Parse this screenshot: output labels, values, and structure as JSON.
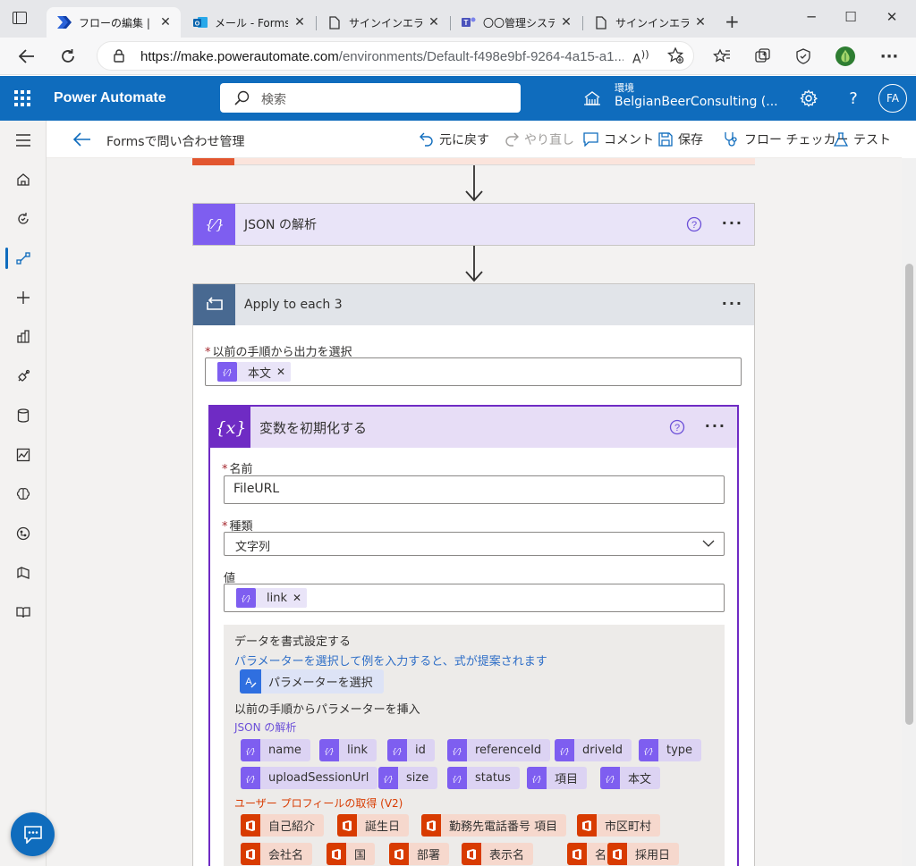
{
  "browser": {
    "tabs": [
      {
        "title": "フローの編集 | Po",
        "icon": "power-automate-icon"
      },
      {
        "title": "メール - Forms /",
        "icon": "outlook-icon"
      },
      {
        "title": "サインインエラー_",
        "icon": "page-icon"
      },
      {
        "title": "〇〇管理システ",
        "icon": "teams-icon"
      },
      {
        "title": "サインインエラー_",
        "icon": "page-icon"
      }
    ],
    "url_main": "https://make.powerautomate.com",
    "url_rest": "/environments/Default-f498e9bf-9264-4a15-a1..."
  },
  "header": {
    "app_title": "Power Automate",
    "search_placeholder": "検索",
    "env_label": "環境",
    "env_name": "BelgianBeerConsulting (...",
    "avatar_initials": "FA"
  },
  "command_bar": {
    "flow_name": "Formsで問い合わせ管理",
    "undo": "元に戻す",
    "redo": "やり直し",
    "comment": "コメント",
    "save": "保存",
    "flow_checker": "フロー チェッカー",
    "test": "テスト"
  },
  "json_step": {
    "title": "JSON の解析"
  },
  "apply_step": {
    "title": "Apply to each 3",
    "field_label": "以前の手順から出力を選択",
    "token": "本文"
  },
  "var_step": {
    "title": "変数を初期化する",
    "name_label": "名前",
    "name_value": "FileURL",
    "type_label": "種類",
    "type_value": "文字列",
    "value_label": "値",
    "value_token": "link"
  },
  "dynamic_panel": {
    "format_heading": "データを書式設定する",
    "format_hint": "パラメーターを選択して例を入力すると、式が提案されます",
    "param_button": "パラメーターを選択",
    "insert_heading": "以前の手順からパラメーターを挿入",
    "json_section": "JSON の解析",
    "json_chips_row1": [
      "name",
      "link",
      "id",
      "referenceId",
      "driveId",
      "type"
    ],
    "json_chips_row2": [
      "uploadSessionUrl",
      "size",
      "status",
      "項目",
      "本文"
    ],
    "profile_section": "ユーザー プロフィールの取得 (V2)",
    "profile_chips_row1": [
      "自己紹介",
      "誕生日",
      "勤務先電話番号 項目",
      "市区町村"
    ],
    "profile_chips_row2": [
      "会社名",
      "国",
      "部署",
      "表示名",
      "名",
      "採用日"
    ]
  },
  "colors": {
    "brand_blue": "#0f6cbd",
    "json_purple": "#7e5ef0",
    "variable_purple": "#6f2bc4",
    "loop_slate": "#486991",
    "office_orange": "#d83b01"
  }
}
